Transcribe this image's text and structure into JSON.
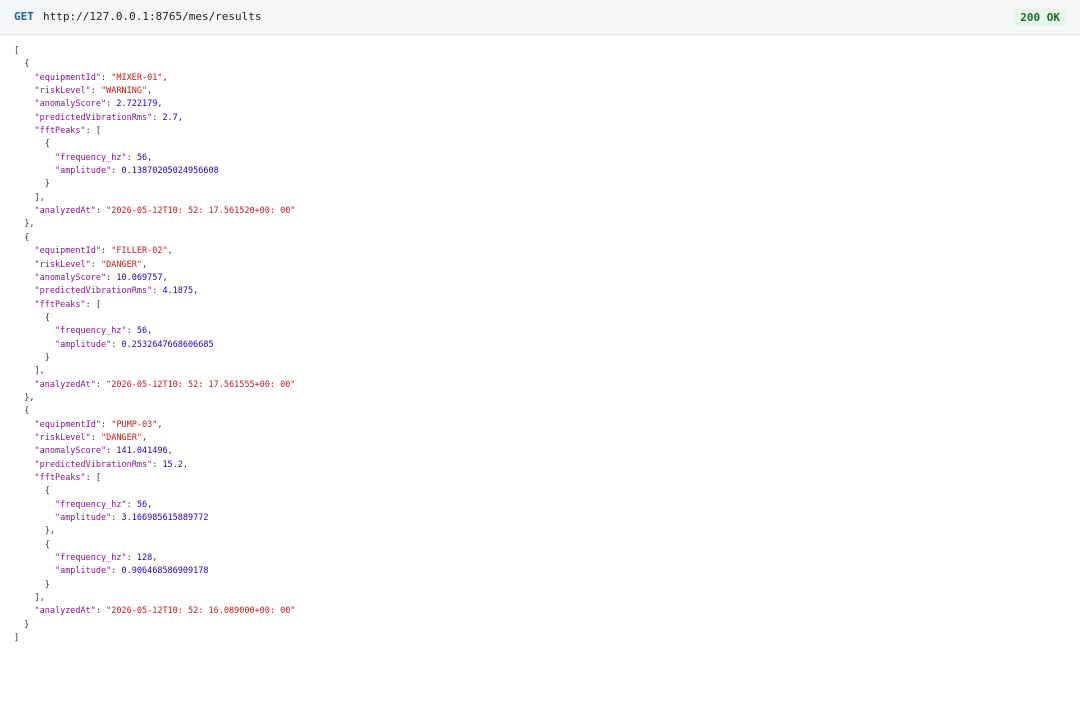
{
  "request": {
    "method": "GET",
    "url": "http://127.0.0.1:8765/mes/results",
    "status": "200 OK"
  },
  "colors": {
    "key": "#881391",
    "string": "#c41a16",
    "number": "#1c00cf",
    "method": "#1f5fa8",
    "status": "#1b6b2c"
  },
  "results": [
    {
      "equipmentId": "MIXER-01",
      "riskLevel": "WARNING",
      "anomalyScore": "2.722179",
      "predictedVibrationRms": "2.7",
      "fftPeaks": [
        {
          "frequency_hz": "56",
          "amplitude": "0.13870205024956608"
        }
      ],
      "analyzedAt": "2026-05-12T10: 52: 17.561520+00: 00"
    },
    {
      "equipmentId": "FILLER-02",
      "riskLevel": "DANGER",
      "anomalyScore": "10.069757",
      "predictedVibrationRms": "4.1875",
      "fftPeaks": [
        {
          "frequency_hz": "56",
          "amplitude": "0.2532647668606685"
        }
      ],
      "analyzedAt": "2026-05-12T10: 52: 17.561555+00: 00"
    },
    {
      "equipmentId": "PUMP-03",
      "riskLevel": "DANGER",
      "anomalyScore": "141.041496",
      "predictedVibrationRms": "15.2",
      "fftPeaks": [
        {
          "frequency_hz": "56",
          "amplitude": "3.166985615889772"
        },
        {
          "frequency_hz": "128",
          "amplitude": "0.906468586909178"
        }
      ],
      "analyzedAt": "2026-05-12T10: 52: 16.089000+00: 00"
    }
  ]
}
